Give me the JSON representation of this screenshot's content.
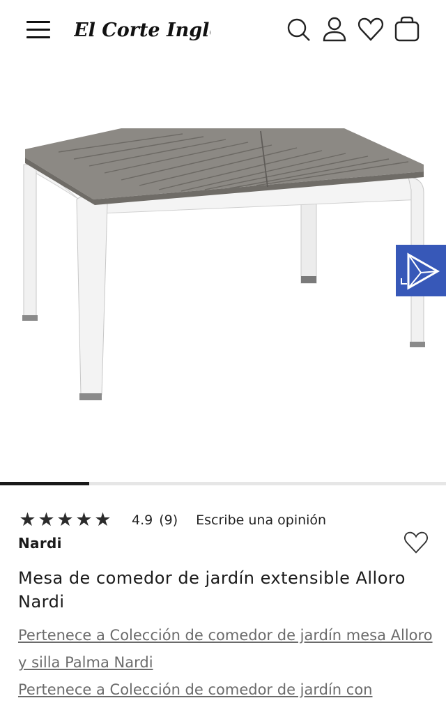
{
  "header": {
    "logo_text": "El Corte Inglés",
    "icons": [
      "menu-icon",
      "search-icon",
      "user-icon",
      "heart-icon",
      "bag-icon"
    ]
  },
  "gallery": {
    "progress": 0.2,
    "ar_button_icon": "ar-view-icon"
  },
  "product": {
    "rating_value": "4.9",
    "rating_count": "(9)",
    "stars": 5,
    "write_review": "Escribe una opinión",
    "brand": "Nardi",
    "title": "Mesa de comedor de jardín extensible Alloro Nardi",
    "collections": [
      "Pertenece a Colección de comedor de jardín mesa Alloro y silla Palma Nardi",
      "Pertenece a Colección de comedor de jardín con"
    ]
  },
  "colors": {
    "accent": "#3758b8",
    "text": "#1a1a1a",
    "link": "#6b6b6b",
    "table_top": "#8a8782",
    "table_frame": "#f2f2f2"
  }
}
